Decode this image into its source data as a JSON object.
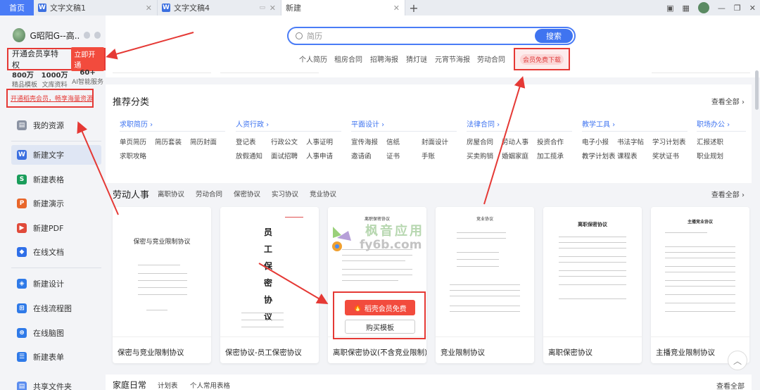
{
  "tabs": {
    "home": "首页",
    "items": [
      {
        "label": "文字文稿1"
      },
      {
        "label": "文字文稿4"
      },
      {
        "label": "新建"
      }
    ]
  },
  "user": {
    "name": "G昭阳G--高..."
  },
  "vip": {
    "text": "开通会员享特权",
    "button": "立即开通"
  },
  "stats": [
    {
      "num": "800万",
      "label": "精品模板"
    },
    {
      "num": "1000万",
      "label": "文库资料"
    },
    {
      "num": "60+",
      "label": "AI智能服务"
    }
  ],
  "super_link": "开通稻壳会员，畅享海量资源",
  "nav": [
    {
      "label": "我的资源",
      "icon": "folder-icon"
    },
    {
      "label": "新建文字",
      "icon": "w"
    },
    {
      "label": "新建表格",
      "icon": "s"
    },
    {
      "label": "新建演示",
      "icon": "p"
    },
    {
      "label": "新建PDF",
      "icon": "pdf"
    },
    {
      "label": "在线文档",
      "icon": "online"
    },
    {
      "label": "新建设计",
      "icon": "design"
    },
    {
      "label": "在线流程图",
      "icon": "flow"
    },
    {
      "label": "在线脑图",
      "icon": "mind"
    },
    {
      "label": "新建表单",
      "icon": "form"
    },
    {
      "label": "共享文件夹",
      "icon": "share"
    }
  ],
  "search": {
    "placeholder": "简历",
    "button": "搜索"
  },
  "hot_tags": [
    "个人简历",
    "租房合同",
    "招聘海报",
    "猜灯谜",
    "元宵节海报",
    "劳动合同",
    "会员免费下载"
  ],
  "recommend": {
    "title": "推荐分类",
    "more": "查看全部",
    "categories": [
      {
        "head": "求职简历",
        "items": [
          "单页简历",
          "简历套装",
          "简历封面",
          "求职攻略"
        ]
      },
      {
        "head": "人资行政",
        "items": [
          "登记表",
          "行政公文",
          "人事证明",
          "放假通知",
          "面试招聘",
          "人事申请"
        ]
      },
      {
        "head": "平面设计",
        "items": [
          "宣传海报",
          "信纸",
          "封面设计",
          "邀请函",
          "证书",
          "手账"
        ]
      },
      {
        "head": "法律合同",
        "items": [
          "房屋合同",
          "劳动人事",
          "投资合作",
          "买卖购销",
          "婚姻家庭",
          "加工揽承"
        ]
      },
      {
        "head": "教学工具",
        "items": [
          "电子小报",
          "书法字帖",
          "学习计划表",
          "教学计划表",
          "课程表",
          "奖状证书"
        ]
      },
      {
        "head": "职场办公",
        "items": [
          "汇报述职",
          "职业规划"
        ]
      }
    ]
  },
  "labor": {
    "title": "劳动人事",
    "more": "查看全部",
    "subtabs": [
      "离职协议",
      "劳动合同",
      "保密协议",
      "实习协议",
      "竞业协议"
    ],
    "cards": [
      {
        "caption": "保密与竞业限制协议",
        "doc_title": "保密与竞业限制协议"
      },
      {
        "caption": "保密协议-员工保密协议",
        "doc_title": "员工保密协议"
      },
      {
        "caption": "离职保密协议(不含竞业限制)",
        "doc_title": "离职保密协议"
      },
      {
        "caption": "竞业限制协议",
        "doc_title": "竞业协议"
      },
      {
        "caption": "离职保密协议",
        "doc_title": "离职保密协议"
      },
      {
        "caption": "主播竞业限制协议",
        "doc_title": "主播竞业协议"
      }
    ],
    "vip_free": "稻壳会员免费",
    "buy": "购买模板"
  },
  "watermark": {
    "cn": "枫音应用",
    "en": "fy6b.com"
  },
  "family": {
    "title": "家庭日常",
    "subtabs": [
      "计划表",
      "个人常用表格"
    ],
    "more": "查看全部"
  },
  "colors": {
    "accent": "#3f74f0",
    "highlight": "#e53935",
    "vip_button": "#f24b3d"
  }
}
